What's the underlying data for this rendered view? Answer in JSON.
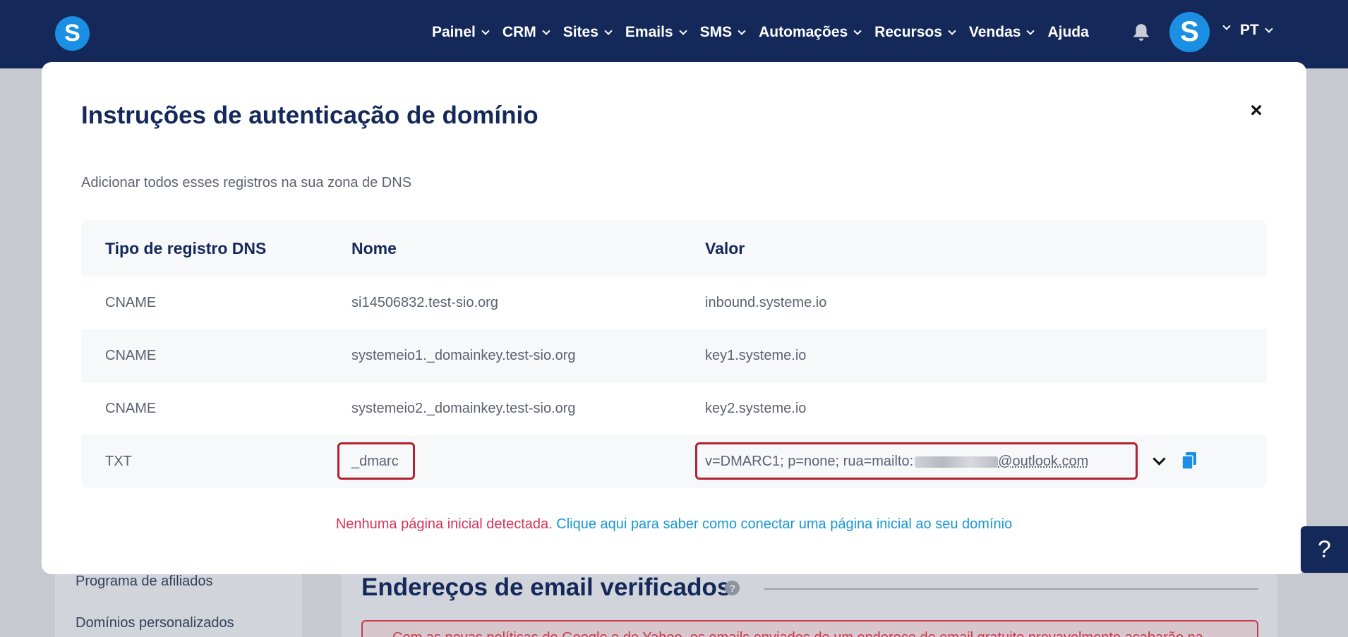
{
  "nav": {
    "logo_letter": "S",
    "items": [
      {
        "label": "Painel"
      },
      {
        "label": "CRM"
      },
      {
        "label": "Sites"
      },
      {
        "label": "Emails"
      },
      {
        "label": "SMS"
      },
      {
        "label": "Automações"
      },
      {
        "label": "Recursos"
      },
      {
        "label": "Vendas"
      },
      {
        "label": "Ajuda"
      }
    ],
    "avatar_letter": "S",
    "language": "PT"
  },
  "background": {
    "sidebar_items": [
      "Programa de afiliados",
      "Domínios personalizados"
    ],
    "section_heading": "Endereços de email verificados",
    "info_icon": "?",
    "alert_text": "Com as novas políticas do Google e do Yahoo, os emails enviados de um endereço de email gratuito provavelmente acabarão na"
  },
  "modal": {
    "title": "Instruções de autenticação de domínio",
    "close_label": "×",
    "subtitle": "Adicionar todos esses registros na sua zona de DNS",
    "table": {
      "headers": [
        "Tipo de registro DNS",
        "Nome",
        "Valor"
      ],
      "rows": [
        {
          "type": "CNAME",
          "name": "si14506832.test-sio.org",
          "value": "inbound.systeme.io"
        },
        {
          "type": "CNAME",
          "name": "systemeio1._domainkey.test-sio.org",
          "value": "key1.systeme.io"
        },
        {
          "type": "CNAME",
          "name": "systemeio2._domainkey.test-sio.org",
          "value": "key2.systeme.io"
        },
        {
          "type": "TXT",
          "name": "_dmarc",
          "value_prefix": "v=DMARC1; p=none; rua=mailto:",
          "value_suffix": "@outlook.com"
        }
      ]
    },
    "warning_text": "Nenhuma página inicial detectada.",
    "link_text": "Clique aqui para saber como conectar uma página inicial ao seu domínio"
  },
  "help_button": "?",
  "colors": {
    "nav_bg": "#14295a",
    "brand_blue": "#1a8fe3",
    "highlight_red": "#b3202d",
    "warning_red": "#d3355a",
    "link_blue": "#1a98d5"
  }
}
